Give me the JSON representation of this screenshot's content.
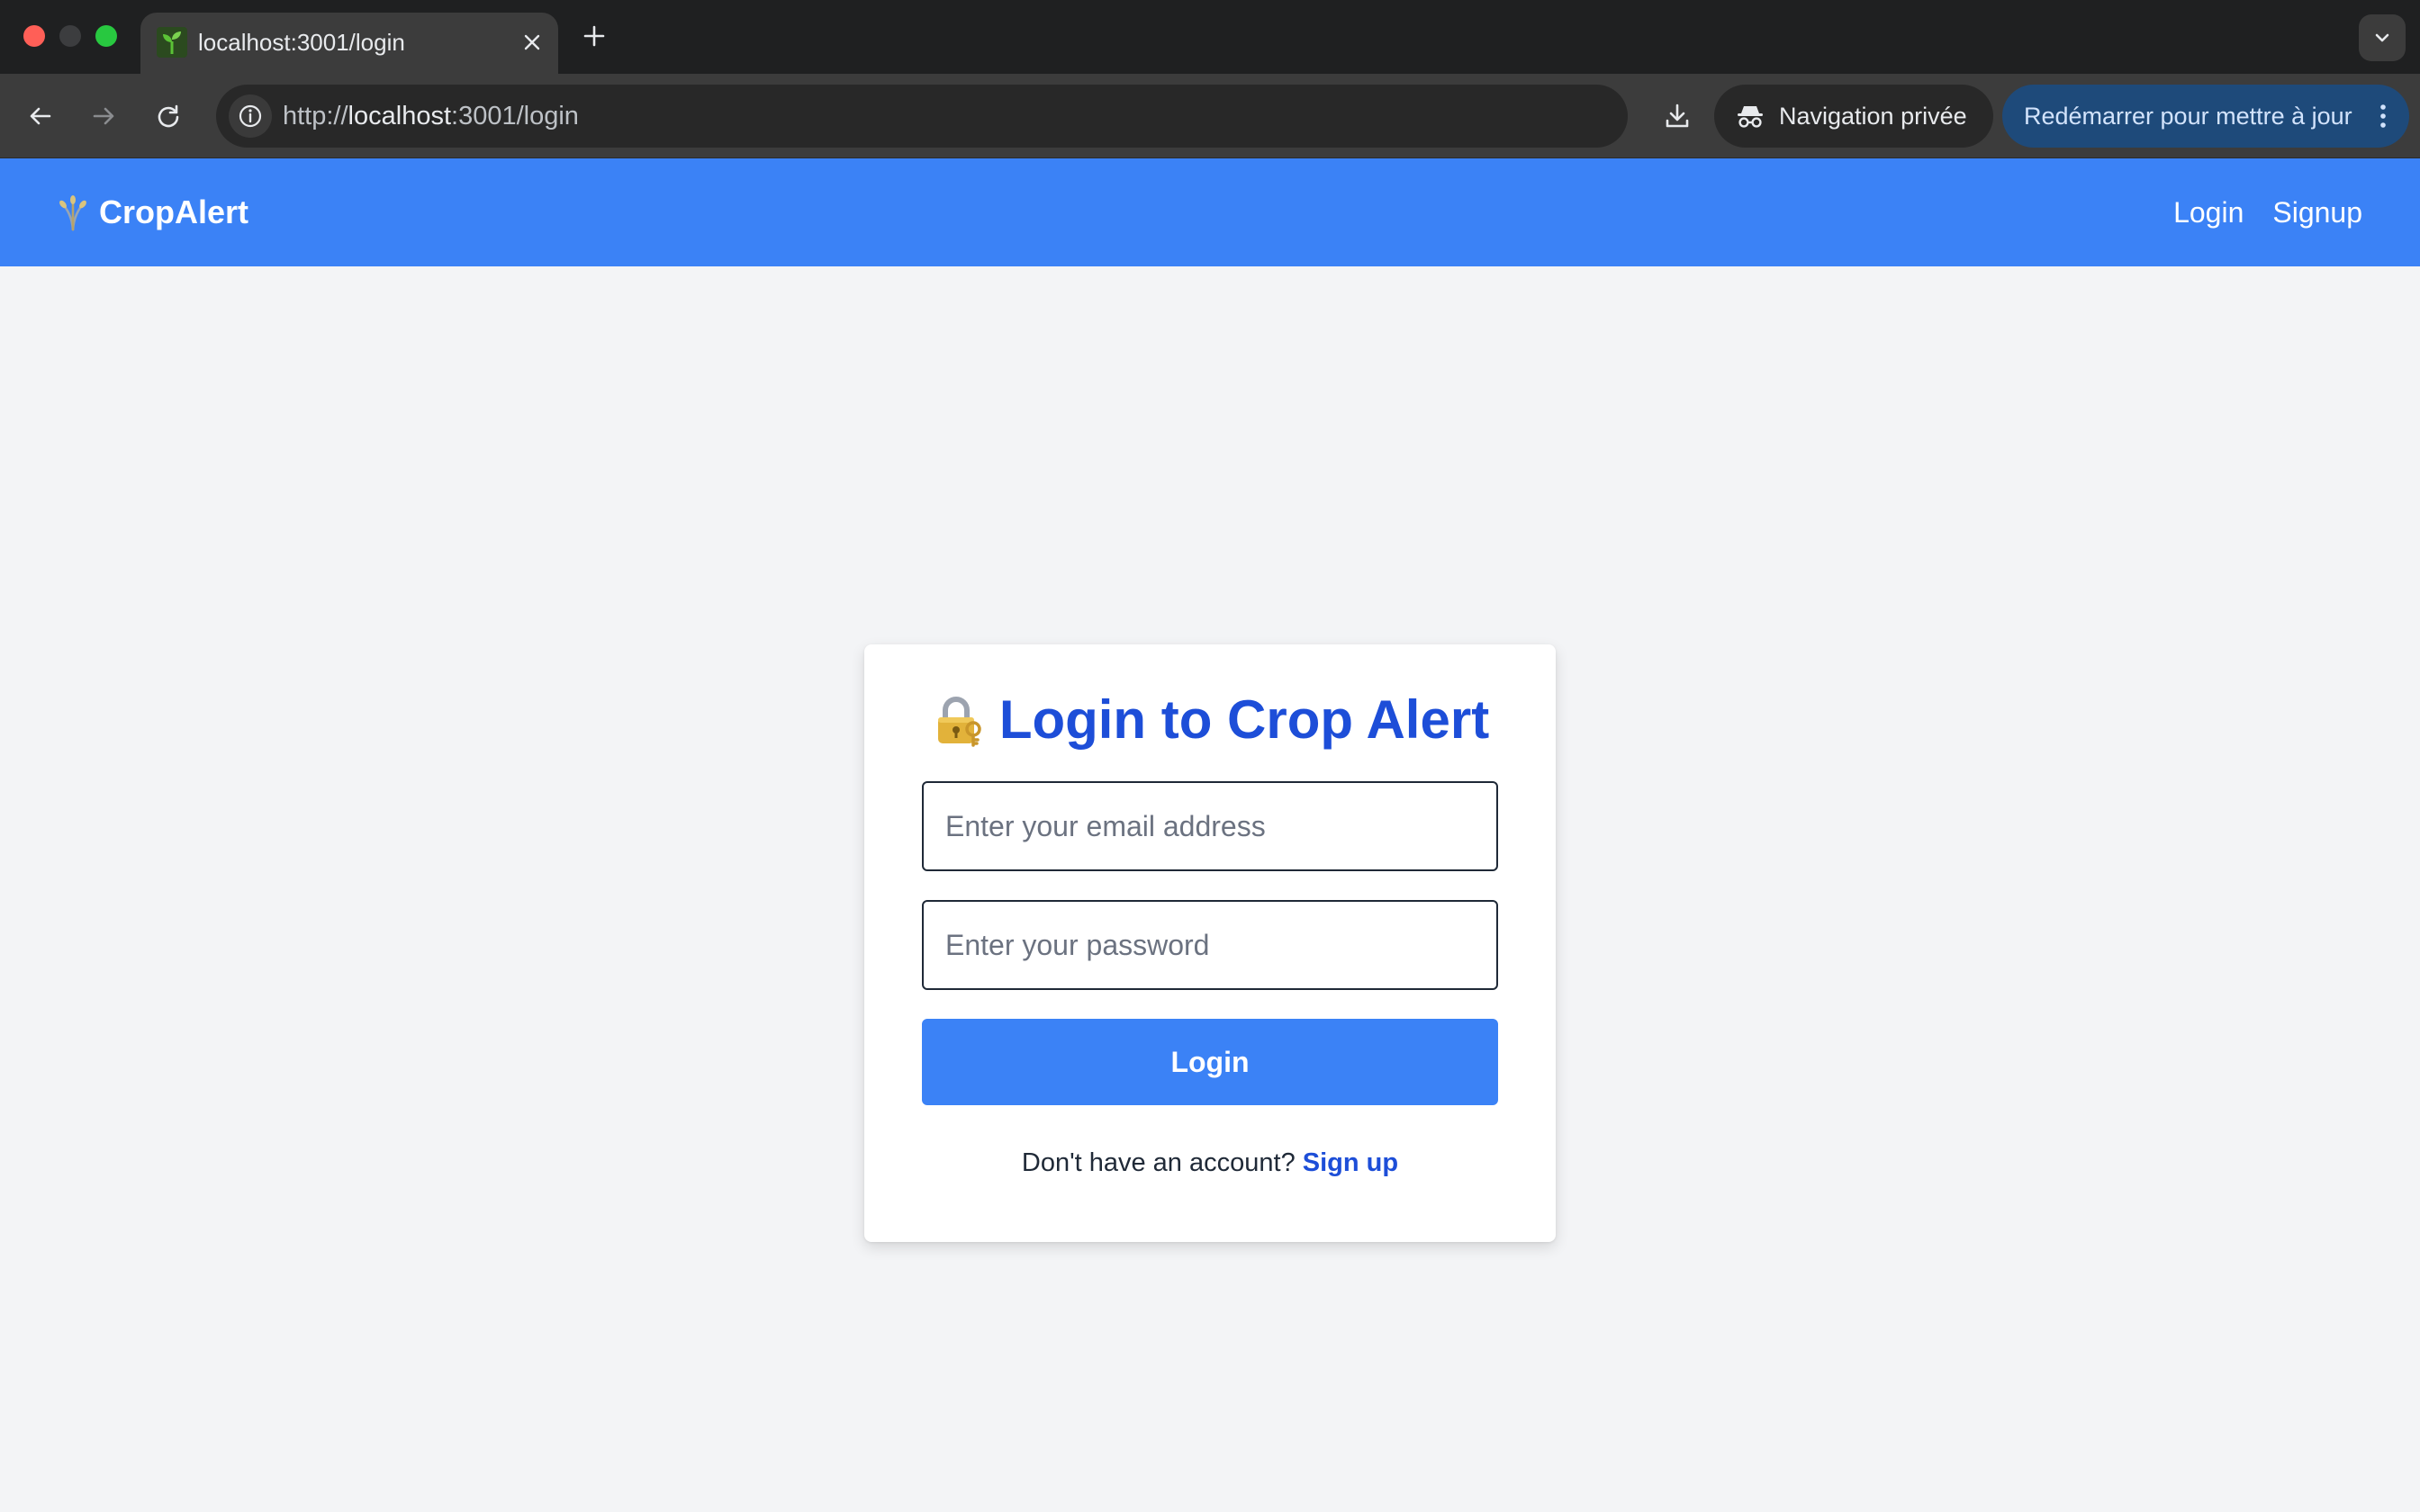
{
  "browser": {
    "tab_title": "localhost:3001/login",
    "url_prefix": "http://",
    "url_host": "localhost",
    "url_rest": ":3001/login",
    "incognito_label": "Navigation privée",
    "update_label": "Redémarrer pour mettre à jour",
    "icons": {
      "back": "arrow-left-icon",
      "forward": "arrow-right-icon",
      "reload": "reload-icon",
      "info": "info-icon",
      "location": "location-pin-icon",
      "bookmark": "star-icon",
      "download": "download-icon",
      "incognito": "incognito-icon",
      "menu": "kebab-menu-icon"
    }
  },
  "app": {
    "brand": "CropAlert",
    "nav_links": [
      "Login",
      "Signup"
    ],
    "primary_color": "#3b82f6",
    "heading_color": "#1d4ed8"
  },
  "login_form": {
    "title": "Login to Crop Alert",
    "email_placeholder": "Enter your email address",
    "password_placeholder": "Enter your password",
    "submit_label": "Login",
    "signup_prompt": "Don't have an account?",
    "signup_link": "Sign up"
  }
}
